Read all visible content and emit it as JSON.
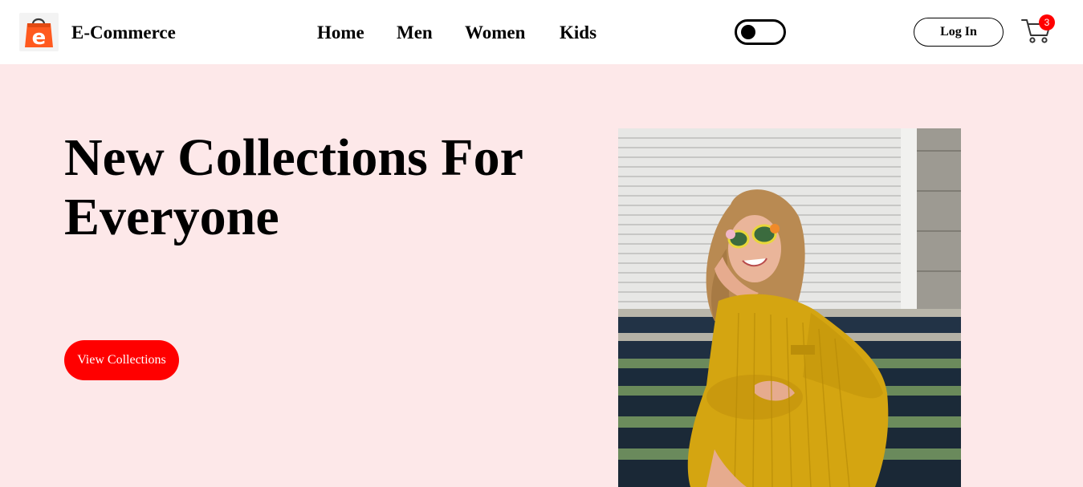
{
  "header": {
    "brand": "E-Commerce",
    "logo_letter": "e",
    "nav": [
      {
        "label": "Home"
      },
      {
        "label": "Men"
      },
      {
        "label": "Women"
      },
      {
        "label": "Kids"
      }
    ],
    "theme_toggle": {
      "icon": "toggle-switch",
      "state": "off"
    },
    "login_label": "Log In",
    "cart": {
      "icon": "cart-icon",
      "count": "3"
    }
  },
  "hero": {
    "title": "New Collections For Everyone",
    "cta_label": "View Collections",
    "image": {
      "subject": "woman in yellow knit dress with sunglasses sitting on steps"
    }
  },
  "colors": {
    "accent": "#ff0000",
    "hero_bg": "#fde8e9",
    "logo_orange": "#ff5a1f",
    "text": "#000000"
  }
}
